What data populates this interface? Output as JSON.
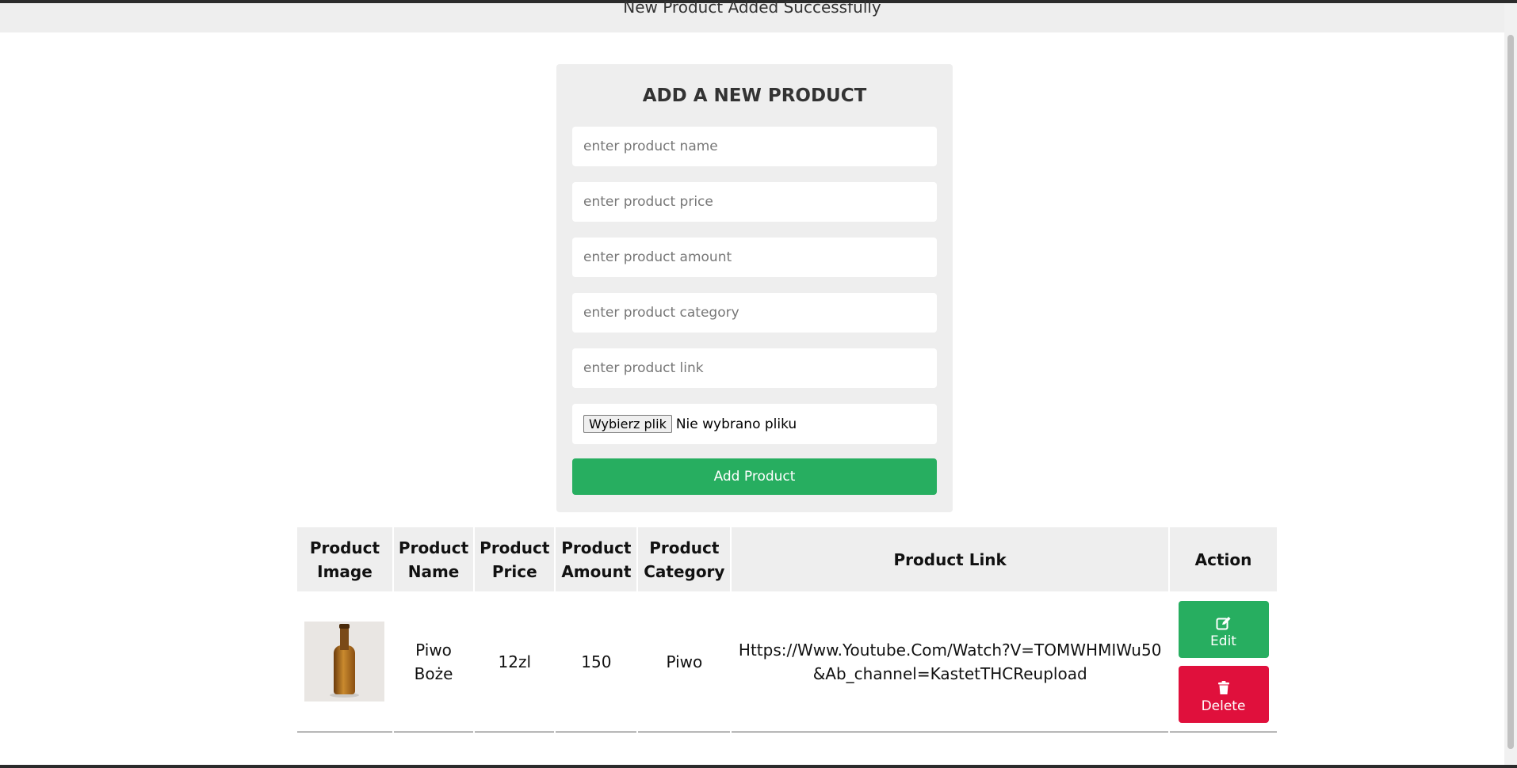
{
  "message": {
    "text": "New Product Added Successfully"
  },
  "form": {
    "title": "ADD A NEW PRODUCT",
    "fields": {
      "name_placeholder": "enter product name",
      "price_placeholder": "enter product price",
      "amount_placeholder": "enter product amount",
      "category_placeholder": "enter product category",
      "link_placeholder": "enter product link"
    },
    "file": {
      "button_label": "Wybierz plik",
      "status": "Nie wybrano pliku"
    },
    "submit_label": "Add Product"
  },
  "table": {
    "headers": [
      "Product Image",
      "Product Name",
      "Product Price",
      "Product Amount",
      "Product Category",
      "Product Link",
      "Action"
    ],
    "rows": [
      {
        "image_icon": "beer-bottle-image",
        "name": "Piwo Boże",
        "price": "12zl",
        "amount": "150",
        "category": "Piwo",
        "link": "Https://Www.Youtube.Com/Watch?V=TOMWHMIWu50&Ab_channel=KastetTHCReupload",
        "edit_label": "Edit",
        "delete_label": "Delete"
      }
    ]
  },
  "colors": {
    "accent_green": "#27ae60",
    "danger_red": "#e0103c",
    "panel_gray": "#eeeeee"
  }
}
